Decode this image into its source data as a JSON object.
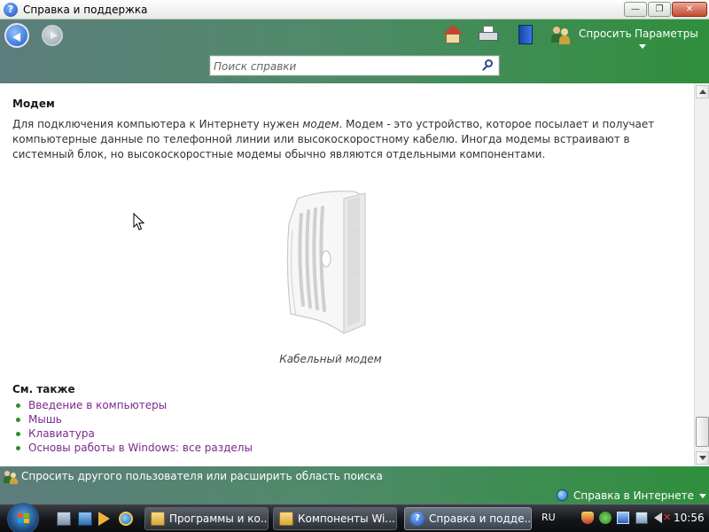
{
  "window": {
    "title": "Справка и поддержка",
    "buttons": {
      "minimize": "—",
      "maximize": "❐",
      "close": "✕"
    }
  },
  "toolbar": {
    "ask_label": "Спросить",
    "options_label": "Параметры",
    "search_placeholder": "Поиск справки",
    "search_value": ""
  },
  "article": {
    "title": "Модем",
    "paragraph_before": "Для подключения компьютера к Интернету нужен ",
    "paragraph_emphasis": "модем",
    "paragraph_after": ". Модем - это устройство, которое посылает и получает компьютерные данные по телефонной линии или высокоскоростному кабелю. Иногда модемы встраивают в системный блок, но высокоскоростные модемы обычно являются отдельными компонентами.",
    "image_caption": "Кабельный модем",
    "see_also_title": "См. также",
    "see_also": [
      "Введение в компьютеры",
      "Мышь",
      "Клавиатура",
      "Основы работы в Windows: все разделы"
    ]
  },
  "footer": {
    "ask_other": "Спросить другого пользователя или расширить область поиска",
    "online_help": "Справка в Интернете"
  },
  "taskbar": {
    "buttons": [
      {
        "label": "Программы и ко...",
        "icon": "folder-icon",
        "active": false
      },
      {
        "label": "Компоненты Wi...",
        "icon": "folder-icon",
        "active": false
      },
      {
        "label": "Справка и подде...",
        "icon": "help-icon",
        "active": true
      }
    ],
    "language": "RU",
    "clock": "10:56"
  },
  "colors": {
    "toolbar_gradient": [
      "#5d7d7c",
      "#2f8f3c"
    ],
    "link": "#7a2a8a",
    "bullet": "#2b8f2b"
  }
}
